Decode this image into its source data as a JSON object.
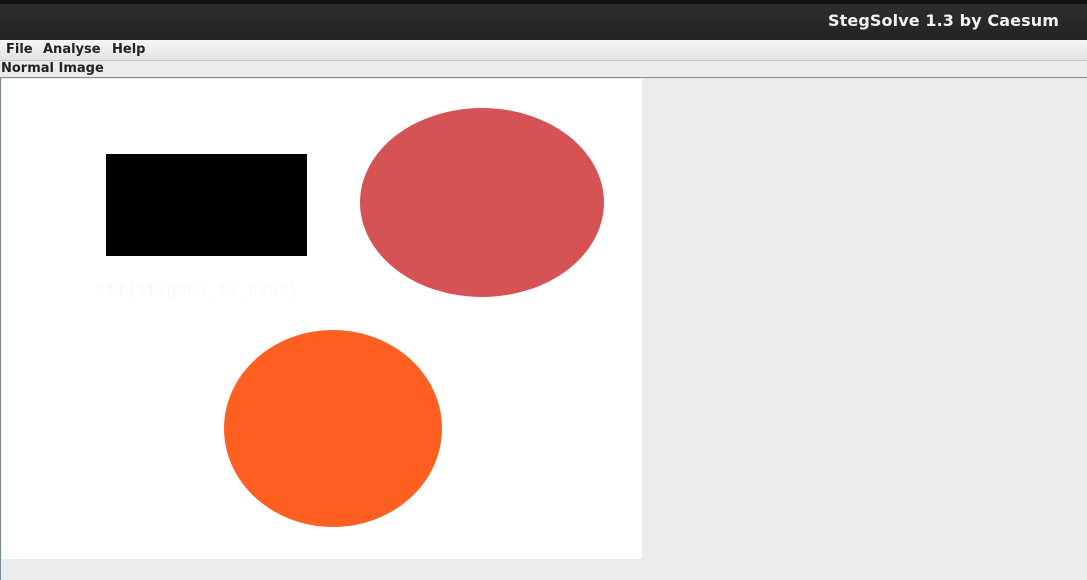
{
  "window": {
    "title": "StegSolve 1.3 by Caesum"
  },
  "menubar": {
    "items": [
      {
        "label": "File"
      },
      {
        "label": "Analyse"
      },
      {
        "label": "Help"
      }
    ]
  },
  "view": {
    "label": "Normal Image"
  },
  "image": {
    "hidden_text": "ctf{st3g0h3_1s_n3at}",
    "colors": {
      "background": "#ffffff",
      "rectangle": "#000000",
      "ellipse_top": "#d65355",
      "ellipse_bottom": "#ff5f21"
    }
  }
}
